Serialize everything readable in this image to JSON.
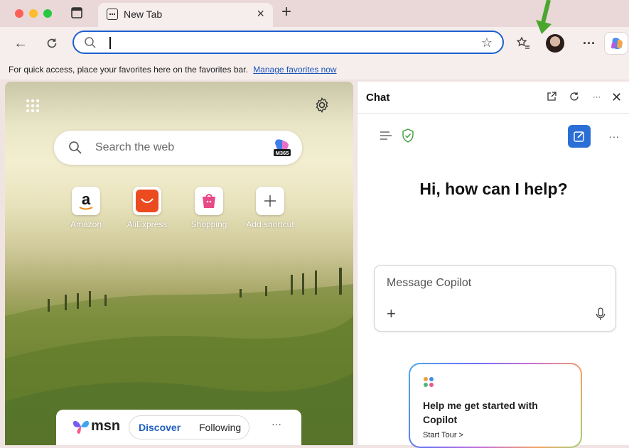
{
  "tab": {
    "title": "New Tab"
  },
  "favbar": {
    "message": "For quick access, place your favorites here on the favorites bar.",
    "link": "Manage favorites now"
  },
  "newtab": {
    "search_placeholder": "Search the web",
    "m365_badge": "M365",
    "shortcuts": [
      {
        "label": "Amazon",
        "icon": "amazon-icon"
      },
      {
        "label": "AliExpress",
        "icon": "aliexpress-icon"
      },
      {
        "label": "Shopping",
        "icon": "shopping-bag-icon"
      },
      {
        "label": "Add shortcut",
        "icon": "plus-icon"
      }
    ],
    "msn": {
      "logo": "msn",
      "discover": "Discover",
      "following": "Following",
      "more": "···"
    }
  },
  "chat": {
    "title": "Chat",
    "greeting": "Hi, how can I help?",
    "composer_placeholder": "Message Copilot",
    "tour_title": "Help me get started with Copilot",
    "tour_link": "Start Tour >"
  },
  "colors": {
    "accent": "#1d5fd0",
    "arrow": "#4aa62e",
    "chat_button": "#2b6fd6",
    "discover": "#1f5fbf"
  }
}
